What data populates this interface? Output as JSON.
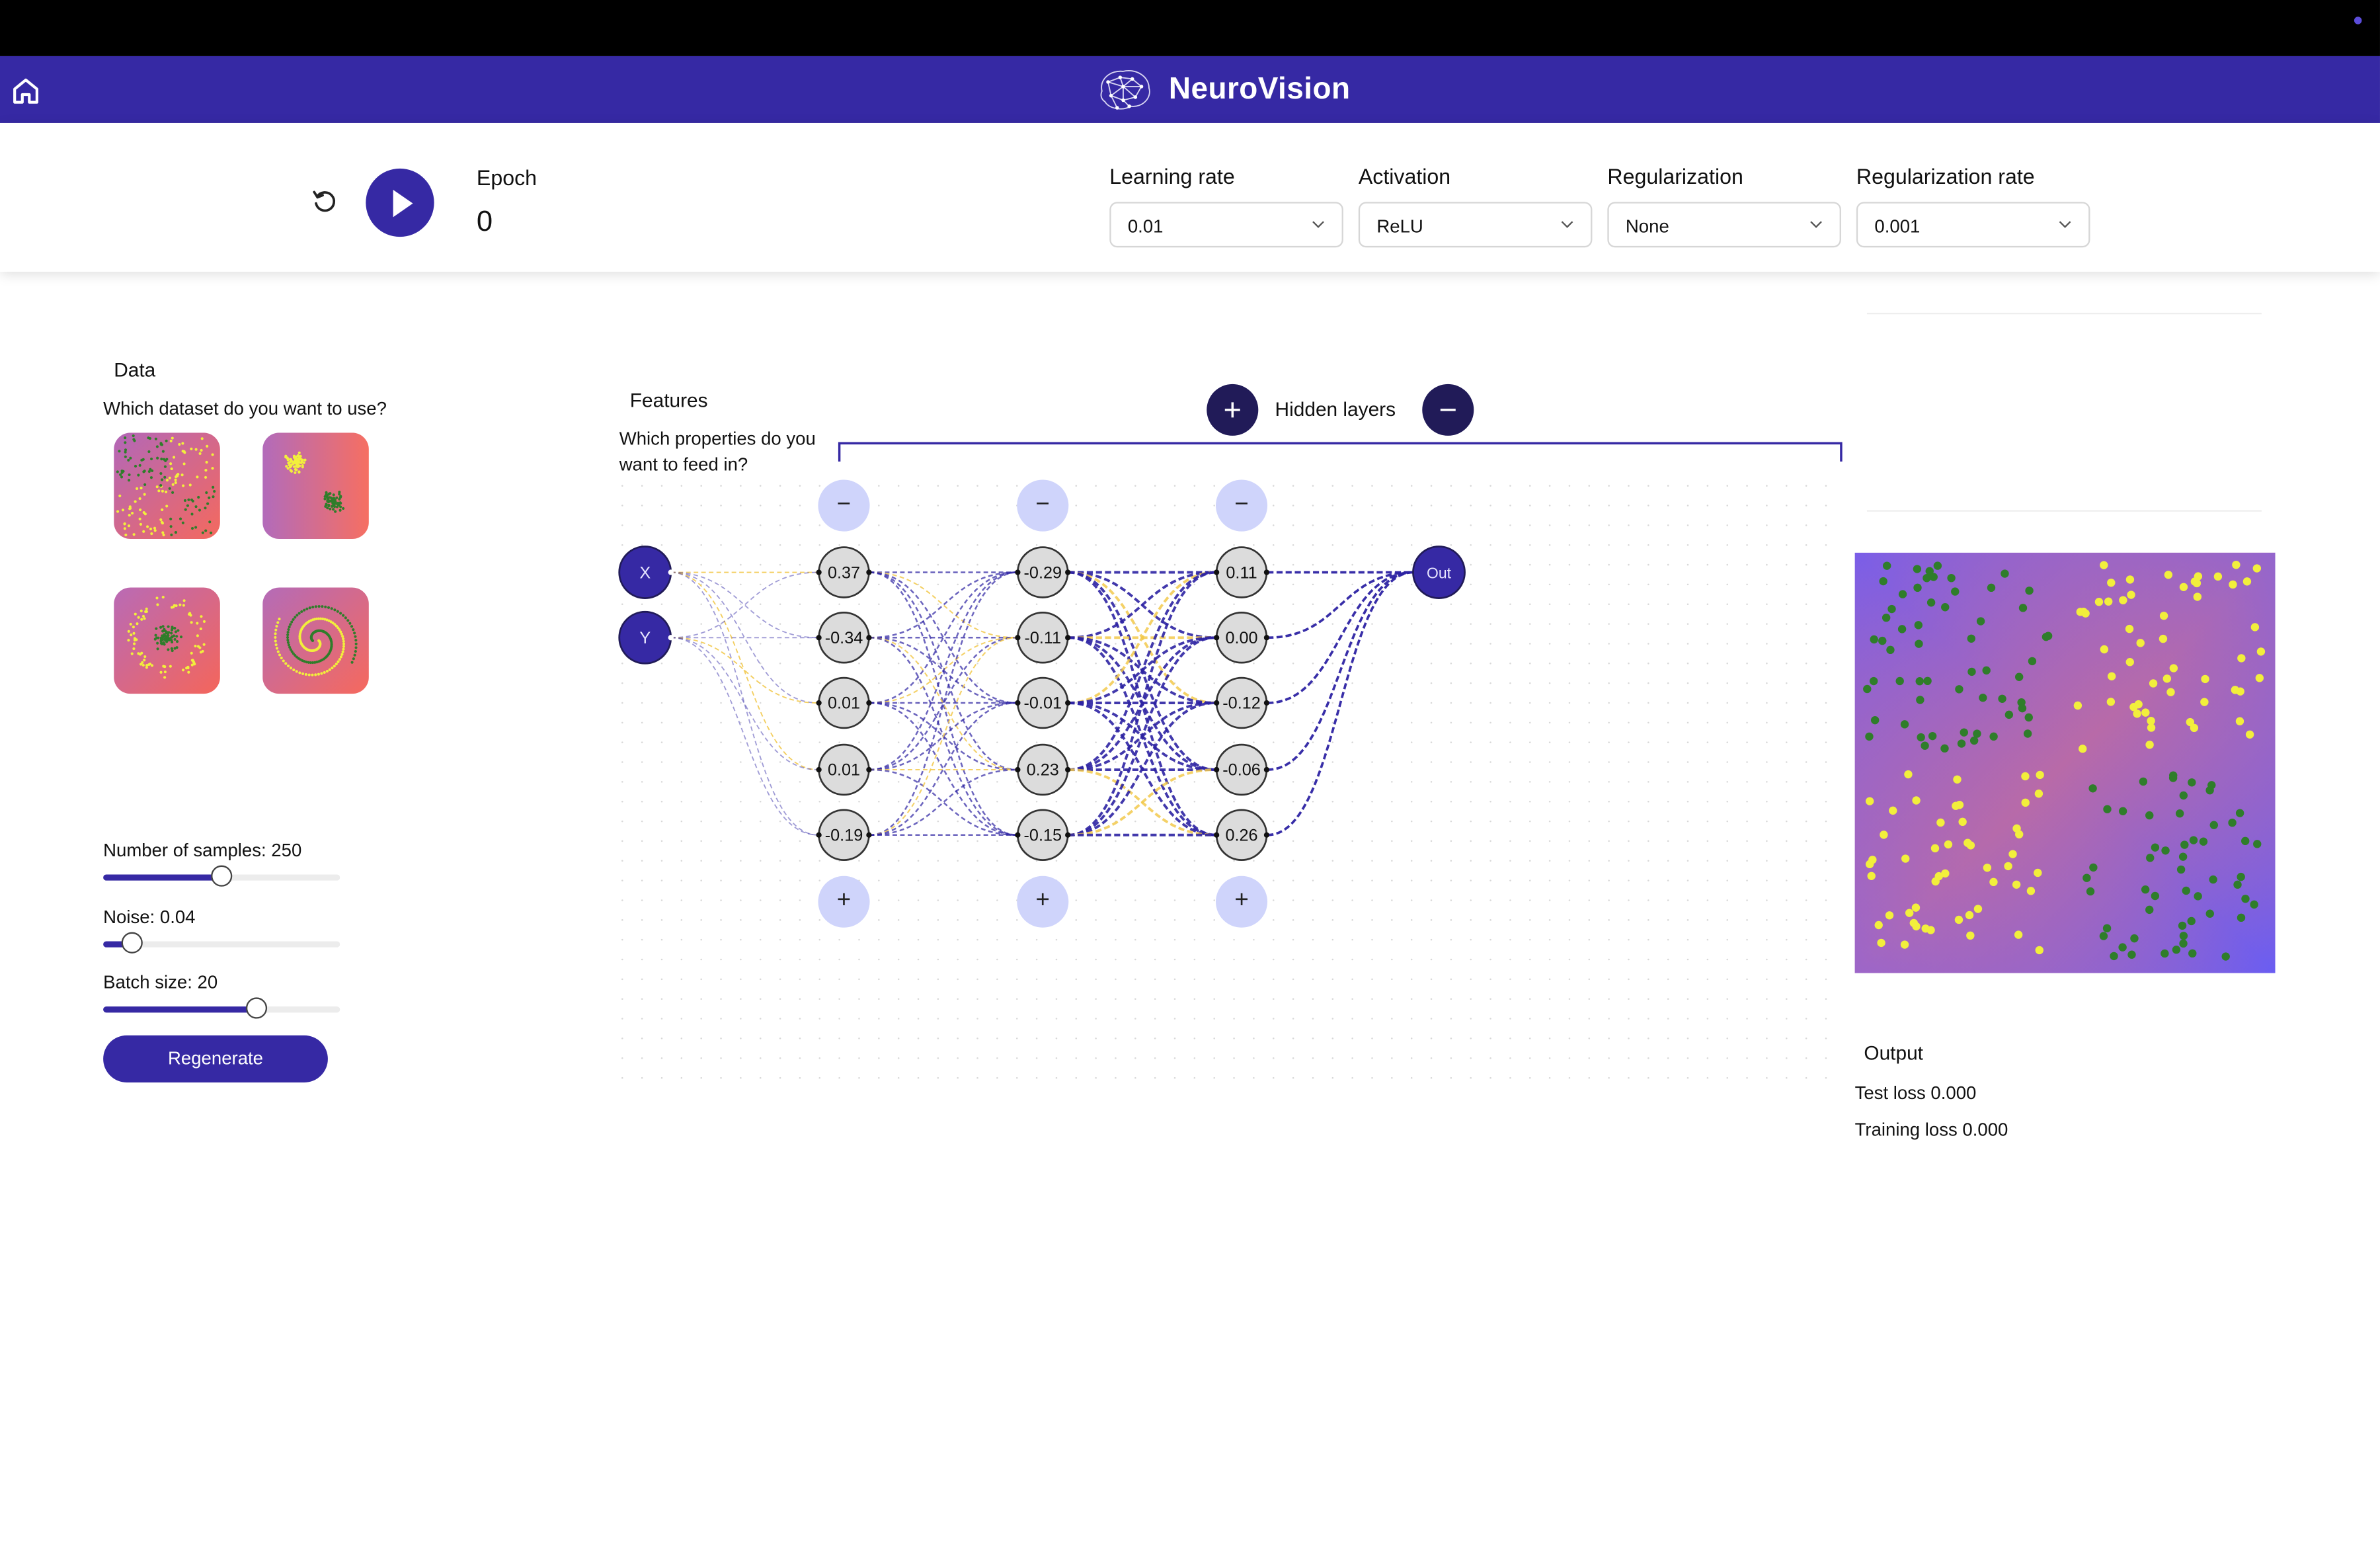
{
  "header": {
    "app_title": "NeuroVision",
    "icons": [
      "home-icon",
      "brain-network-logo"
    ],
    "colors": {
      "nav": "#3629a4",
      "accent_dark": "#211b58",
      "node_light": "#cfd4fb"
    }
  },
  "controls": {
    "epoch_label": "Epoch",
    "epoch_value": "0",
    "dropdowns": [
      {
        "label": "Learning rate",
        "value": "0.01"
      },
      {
        "label": "Activation",
        "value": "ReLU"
      },
      {
        "label": "Regularization",
        "value": "None"
      },
      {
        "label": "Regularization rate",
        "value": "0.001"
      }
    ]
  },
  "data_panel": {
    "title": "Data",
    "question": "Which dataset do you want to use?",
    "datasets": [
      "xor",
      "gaussian",
      "circle",
      "spiral"
    ],
    "sliders": [
      {
        "label": "Number of samples: 250",
        "fraction": 0.5
      },
      {
        "label": "Noise: 0.04",
        "fraction": 0.12
      },
      {
        "label": "Batch size: 20",
        "fraction": 0.65
      }
    ],
    "regenerate_label": "Regenerate"
  },
  "network": {
    "features_title": "Features",
    "features_question": "Which properties do you want to feed in?",
    "hidden_layers_label": "Hidden layers",
    "inputs": [
      "X",
      "Y"
    ],
    "layers": [
      [
        "0.37",
        "-0.34",
        "0.01",
        "0.01",
        "-0.19"
      ],
      [
        "-0.29",
        "-0.11",
        "-0.01",
        "0.23",
        "-0.15"
      ],
      [
        "0.11",
        "0.00",
        "-0.12",
        "-0.06",
        "0.26"
      ]
    ],
    "output_label": "Out",
    "minus_symbol": "−",
    "plus_symbol": "+"
  },
  "output": {
    "title": "Output",
    "test_loss": "Test loss 0.000",
    "training_loss": "Training loss 0.000"
  }
}
